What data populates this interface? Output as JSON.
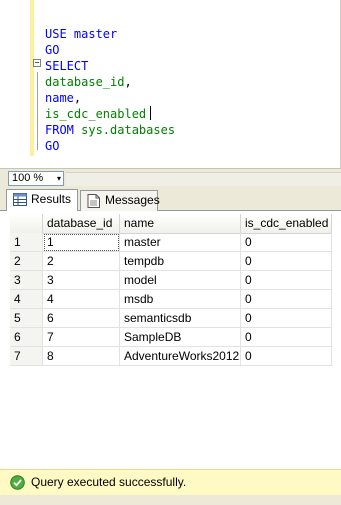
{
  "editor": {
    "lines": [
      {
        "parts": [
          {
            "t": "USE",
            "c": "kw"
          },
          {
            "t": " master",
            "c": "kw"
          }
        ]
      },
      {
        "parts": [
          {
            "t": "GO",
            "c": "kw"
          }
        ]
      },
      {
        "parts": [
          {
            "t": "SELECT",
            "c": "kw"
          }
        ]
      },
      {
        "parts": [
          {
            "t": "database_id",
            "c": "obj"
          },
          {
            "t": ",",
            "c": ""
          }
        ]
      },
      {
        "parts": [
          {
            "t": "name",
            "c": "kw"
          },
          {
            "t": ",",
            "c": ""
          }
        ]
      },
      {
        "parts": [
          {
            "t": "is_cdc_enabled",
            "c": "obj"
          },
          {
            "t": "",
            "c": "caret"
          }
        ]
      },
      {
        "parts": [
          {
            "t": "FROM",
            "c": "kw"
          },
          {
            "t": " sys.databases",
            "c": "obj"
          }
        ]
      },
      {
        "parts": [
          {
            "t": "GO",
            "c": "kw"
          }
        ]
      }
    ],
    "fold_symbol": "−"
  },
  "zoom": {
    "value": "100 %",
    "arrow": "▾"
  },
  "tabs": {
    "results": "Results",
    "messages": "Messages"
  },
  "grid": {
    "columns": [
      "database_id",
      "name",
      "is_cdc_enabled"
    ],
    "rows": [
      {
        "n": "1",
        "database_id": "1",
        "name": "master",
        "is_cdc_enabled": "0"
      },
      {
        "n": "2",
        "database_id": "2",
        "name": "tempdb",
        "is_cdc_enabled": "0"
      },
      {
        "n": "3",
        "database_id": "3",
        "name": "model",
        "is_cdc_enabled": "0"
      },
      {
        "n": "4",
        "database_id": "4",
        "name": "msdb",
        "is_cdc_enabled": "0"
      },
      {
        "n": "5",
        "database_id": "6",
        "name": "semanticsdb",
        "is_cdc_enabled": "0"
      },
      {
        "n": "6",
        "database_id": "7",
        "name": "SampleDB",
        "is_cdc_enabled": "0"
      },
      {
        "n": "7",
        "database_id": "8",
        "name": "AdventureWorks2012",
        "is_cdc_enabled": "0"
      }
    ]
  },
  "status": {
    "text": "Query executed successfully.",
    "icon": "success-check-icon"
  },
  "colors": {
    "keyword": "#0000ff",
    "object": "#008000",
    "status_bg": "#fff9c4"
  }
}
